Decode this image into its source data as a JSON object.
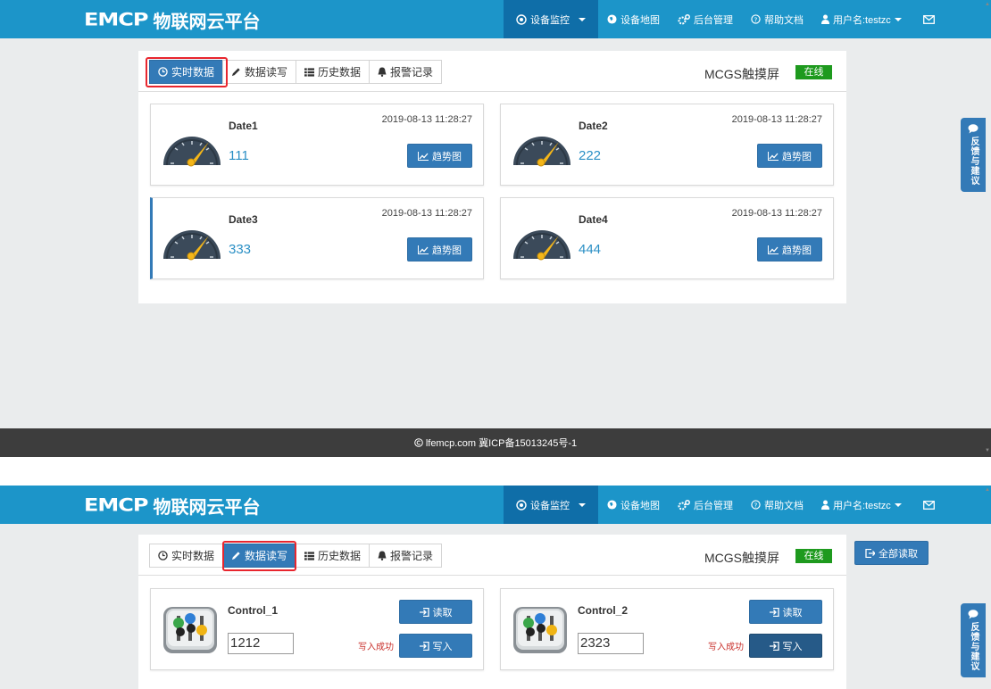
{
  "brand": {
    "logo": "EMCP",
    "name": "物联网云平台"
  },
  "nav": {
    "items": [
      {
        "label": "设备监控",
        "icon": "eye-icon"
      },
      {
        "label": "设备地图",
        "icon": "globe-icon"
      },
      {
        "label": "后台管理",
        "icon": "gears-icon"
      },
      {
        "label": "帮助文档",
        "icon": "question-circle-icon"
      },
      {
        "label": "用户名:testzc",
        "icon": "user-icon"
      }
    ],
    "mail_icon": "envelope-icon"
  },
  "tabs": [
    {
      "label": "实时数据",
      "icon": "clock-icon"
    },
    {
      "label": "数据读写",
      "icon": "pencil-icon"
    },
    {
      "label": "历史数据",
      "icon": "list-icon"
    },
    {
      "label": "报警记录",
      "icon": "bell-icon"
    }
  ],
  "device": {
    "name": "MCGS触摸屏",
    "status": "在线",
    "status_color": "#1e9a1e"
  },
  "realtime_cards": [
    {
      "title": "Date1",
      "time": "2019-08-13 11:28:27",
      "value": "111",
      "button": "趋势图"
    },
    {
      "title": "Date2",
      "time": "2019-08-13 11:28:27",
      "value": "222",
      "button": "趋势图"
    },
    {
      "title": "Date3",
      "time": "2019-08-13 11:28:27",
      "value": "333",
      "button": "趋势图"
    },
    {
      "title": "Date4",
      "time": "2019-08-13 11:28:27",
      "value": "444",
      "button": "趋势图"
    }
  ],
  "rw": {
    "read_all": "全部读取",
    "controls": [
      {
        "title": "Control_1",
        "value": "1212",
        "read": "读取",
        "write": "写入",
        "message": "写入成功"
      },
      {
        "title": "Control_2",
        "value": "2323",
        "read": "读取",
        "write": "写入",
        "message": "写入成功"
      }
    ]
  },
  "footer": {
    "text": "lfemcp.com 冀ICP备15013245号-1"
  },
  "feedback": {
    "label": "反馈与建议"
  },
  "colors": {
    "navbar": "#1c95c9",
    "primary": "#337ab7",
    "highlight": "#e8262e",
    "value": "#2a8fc5"
  }
}
